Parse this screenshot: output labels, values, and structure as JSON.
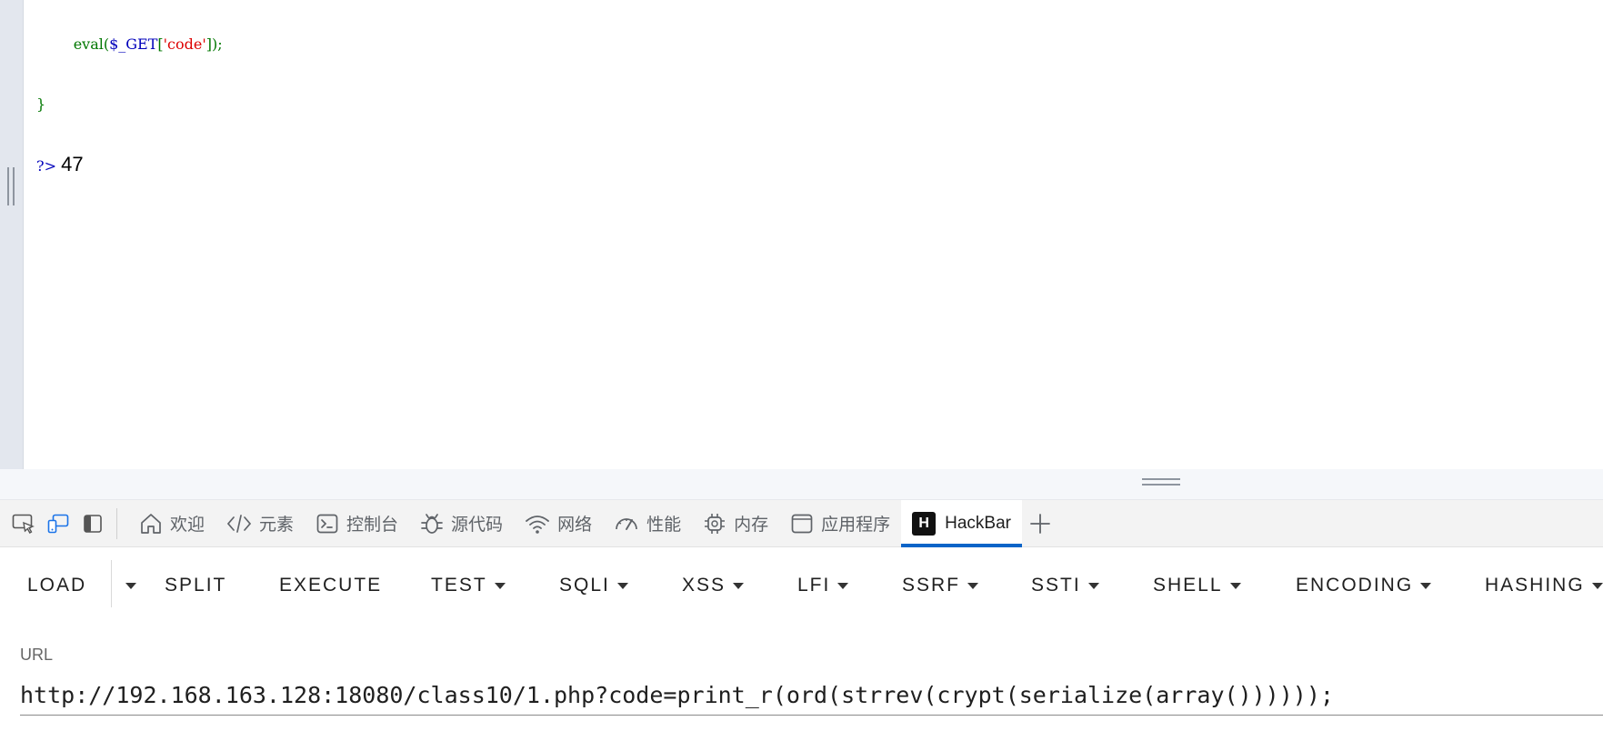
{
  "page": {
    "code_lines": {
      "line1_indent": "        ",
      "line1_func": "eval(",
      "line1_var": "$_GET",
      "line1_open": "[",
      "line1_string": "'code'",
      "line1_close": "]);",
      "line2_brace": "}",
      "line3_tag": "?>",
      "output": "47"
    }
  },
  "devtools": {
    "tabs": [
      {
        "label": "欢迎",
        "icon": "home-icon"
      },
      {
        "label": "元素",
        "icon": "code-icon"
      },
      {
        "label": "控制台",
        "icon": "console-icon"
      },
      {
        "label": "源代码",
        "icon": "bug-icon"
      },
      {
        "label": "网络",
        "icon": "wifi-icon"
      },
      {
        "label": "性能",
        "icon": "gauge-icon"
      },
      {
        "label": "内存",
        "icon": "chip-icon"
      },
      {
        "label": "应用程序",
        "icon": "app-window-icon"
      },
      {
        "label": "HackBar",
        "icon": "hackbar-logo-icon",
        "logo_letter": "H",
        "active": true
      }
    ]
  },
  "hackbar": {
    "toolbar": {
      "load": "LOAD",
      "split": "SPLIT",
      "execute": "EXECUTE",
      "test": "TEST",
      "sqli": "SQLI",
      "xss": "XSS",
      "lfi": "LFI",
      "ssrf": "SSRF",
      "ssti": "SSTI",
      "shell": "SHELL",
      "encoding": "ENCODING",
      "hashing": "HASHING"
    },
    "url_label": "URL",
    "url_value": "http://192.168.163.128:18080/class10/1.php?code=print_r(ord(strrev(crypt(serialize(array())))));"
  }
}
